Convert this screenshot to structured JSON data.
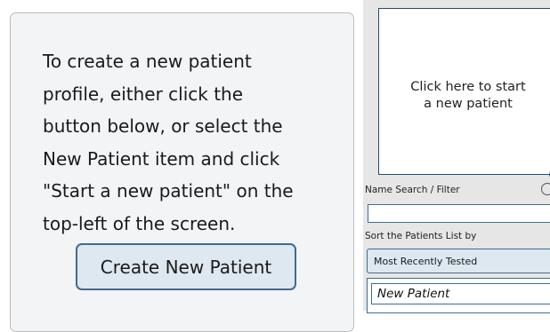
{
  "info_card": {
    "text": "To create a new patient\nprofile, either click the\nbutton below, or select the\nNew Patient item and click\n\"Start a new patient\" on the\ntop-left of the screen.",
    "create_button_label": "Create New Patient"
  },
  "sidebar": {
    "start_tile_label": "Click here to start\na new patient",
    "start_tile_icon": "pencil-icon",
    "search_label": "Name Search / Filter",
    "search_value": "",
    "clear_icon": "clear-search-icon",
    "sort_label": "Sort the Patients List by",
    "sort_selected": "Most Recently Tested",
    "patients": [
      "New Patient"
    ]
  },
  "colors": {
    "accent_border": "#3f6c8f",
    "button_fill": "#dde8f0",
    "card_background": "#f3f4f6"
  }
}
